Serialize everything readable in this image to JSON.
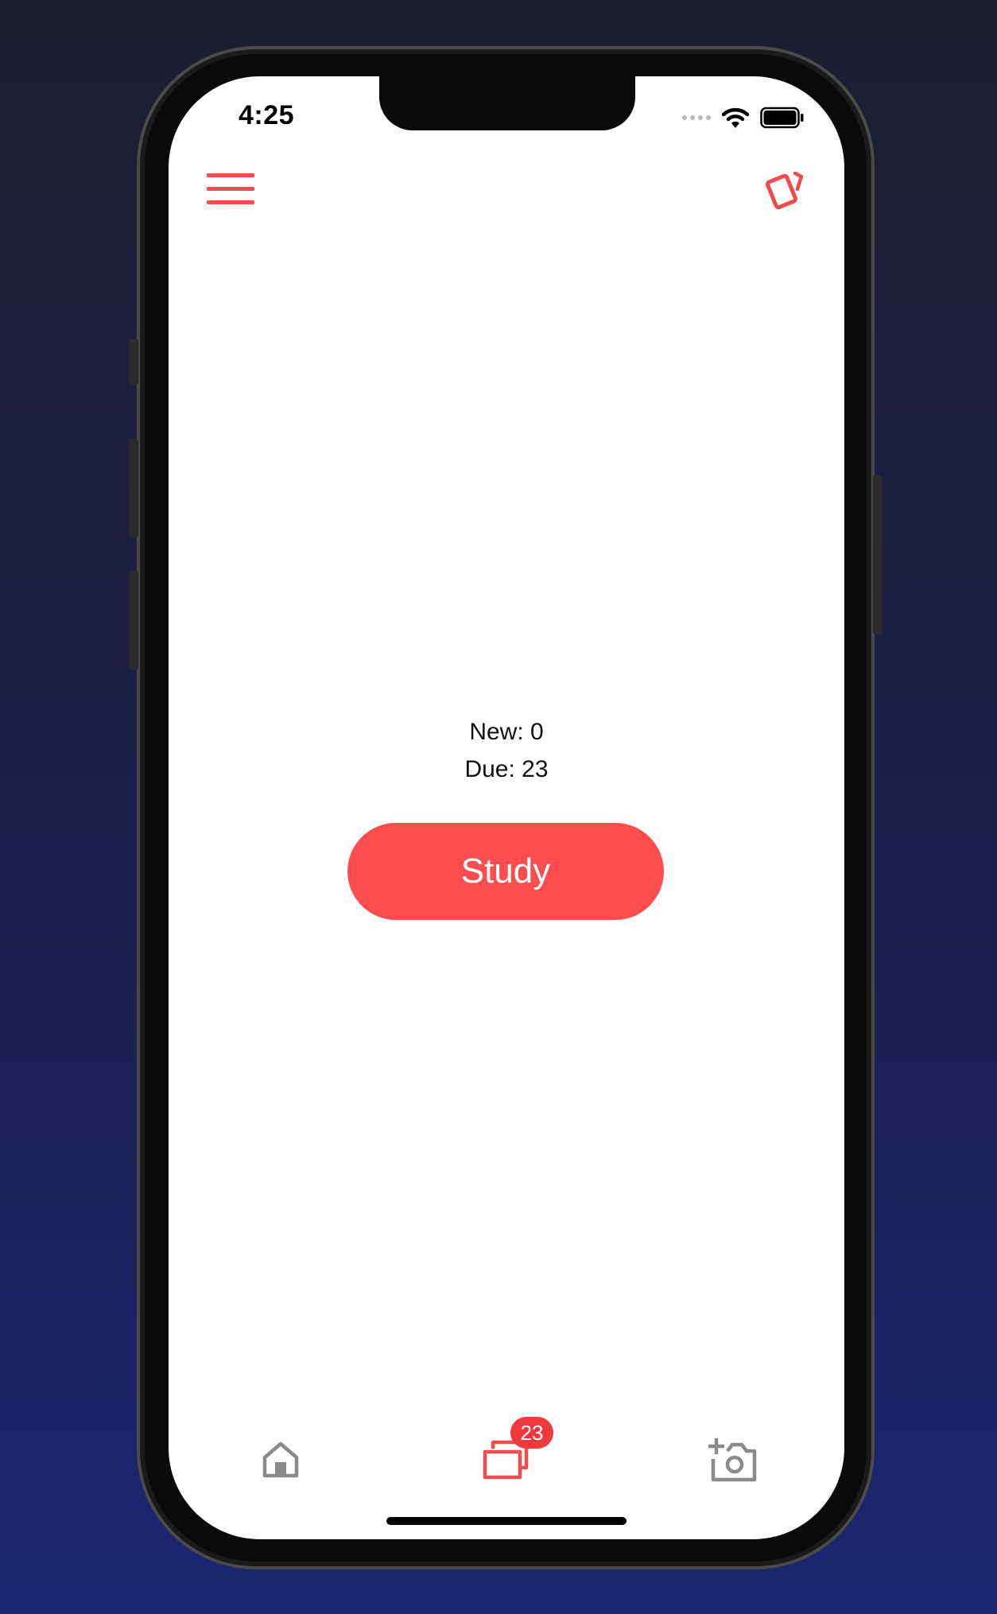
{
  "status_bar": {
    "time": "4:25"
  },
  "header": {
    "menu_icon": "hamburger-icon",
    "action_icon": "cards-icon"
  },
  "deck_stats": {
    "new_label": "New: 0",
    "due_label": "Due: 23"
  },
  "study_button": {
    "label": "Study"
  },
  "tab_bar": {
    "items": [
      {
        "icon": "home-icon",
        "active": false
      },
      {
        "icon": "cards-stack-icon",
        "active": true,
        "badge": "23"
      },
      {
        "icon": "add-photo-icon",
        "active": false
      }
    ]
  },
  "colors": {
    "accent": "#fd4d4f",
    "inactive_icon": "#8a8a8a",
    "background_top": "#1c1d2e",
    "background_bottom": "#1b2673"
  }
}
